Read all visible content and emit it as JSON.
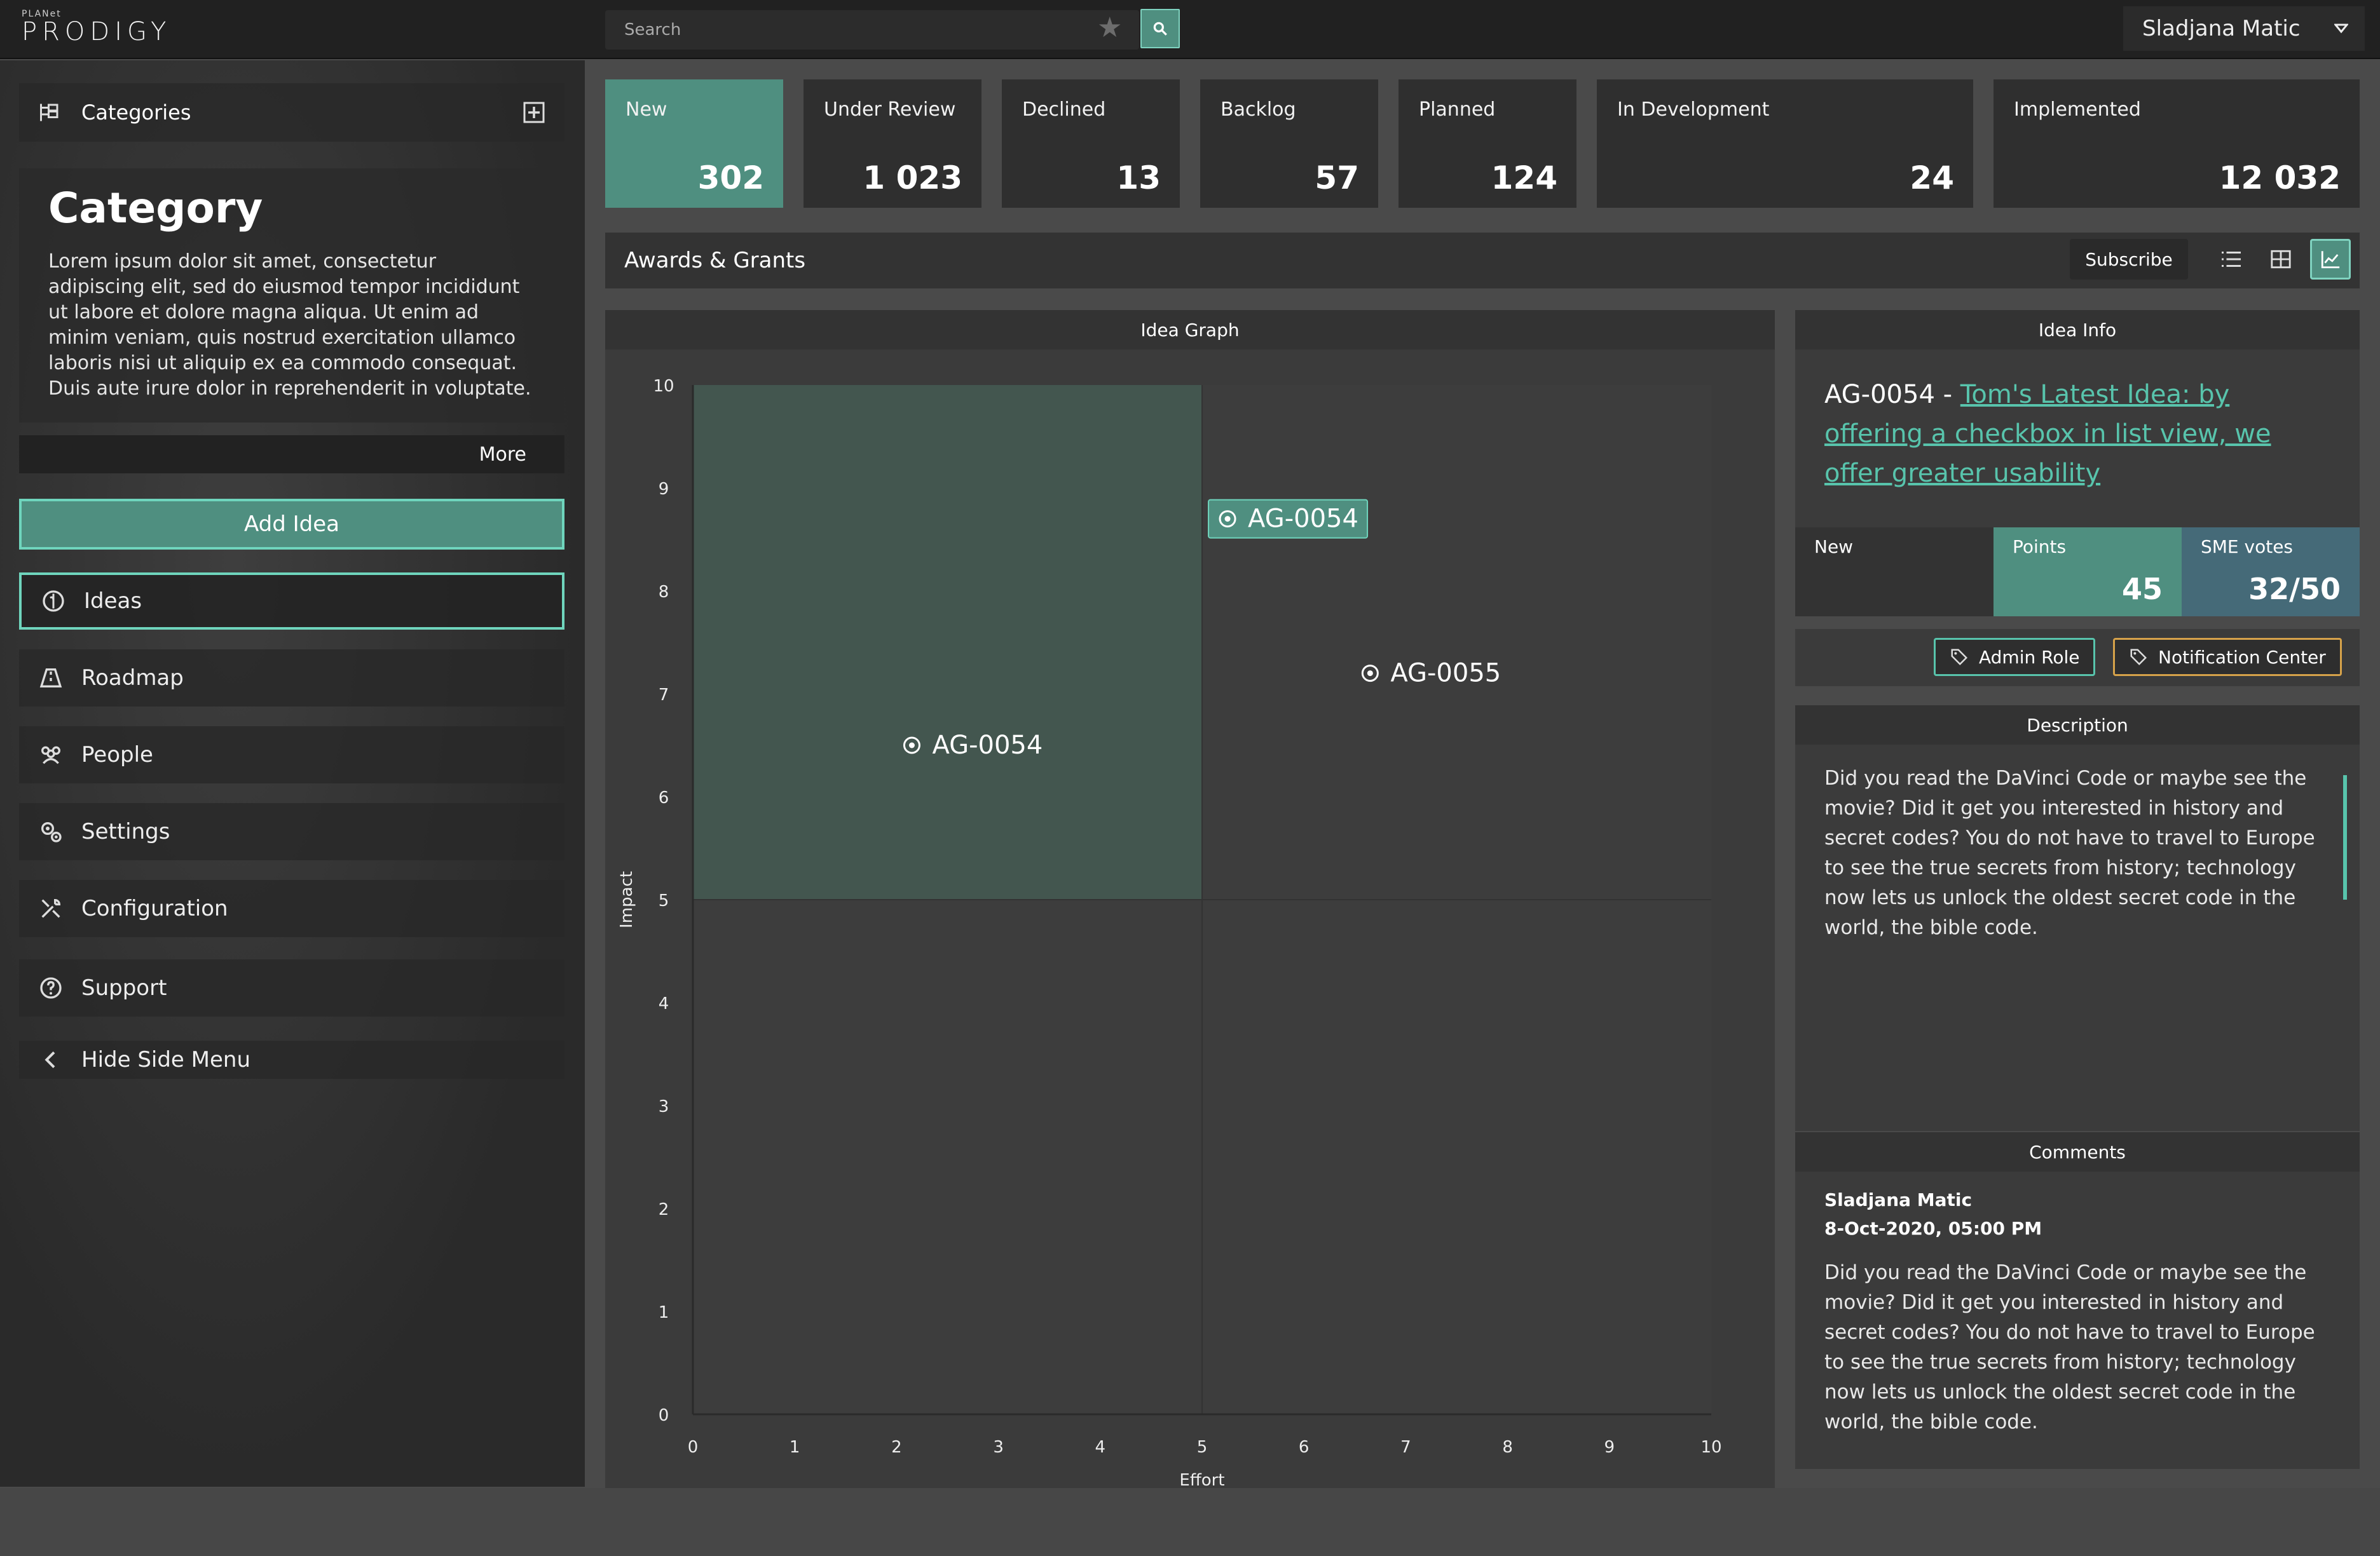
{
  "header": {
    "logo_small": "PLANet",
    "logo_main": "PRODIGY",
    "search_placeholder": "Search",
    "user_name": "Sladjana Matic"
  },
  "sidebar": {
    "categories_label": "Categories",
    "category": {
      "title": "Category",
      "text": "Lorem ipsum dolor sit amet, consectetur adipiscing elit, sed do eiusmod tempor incididunt ut labore et dolore magna aliqua. Ut enim ad minim veniam, quis nostrud exercitation ullamco laboris nisi ut aliquip ex ea commodo consequat. Duis aute irure dolor in reprehenderit in voluptate.",
      "more_label": "More"
    },
    "add_idea_label": "Add Idea",
    "items": [
      {
        "label": "Ideas",
        "icon": "ideas-icon"
      },
      {
        "label": "Roadmap",
        "icon": "roadmap-icon"
      },
      {
        "label": "People",
        "icon": "people-icon"
      },
      {
        "label": "Settings",
        "icon": "settings-icon"
      },
      {
        "label": "Configuration",
        "icon": "configuration-icon"
      },
      {
        "label": "Support",
        "icon": "support-icon"
      },
      {
        "label": "Hide Side Menu",
        "icon": "chevron-left-icon"
      }
    ]
  },
  "statuses": [
    {
      "label": "New",
      "value": "302"
    },
    {
      "label": "Under Review",
      "value": "1 023"
    },
    {
      "label": "Declined",
      "value": "13"
    },
    {
      "label": "Backlog",
      "value": "57"
    },
    {
      "label": "Planned",
      "value": "124"
    },
    {
      "label": "In Development",
      "value": "24"
    },
    {
      "label": "Implemented",
      "value": "12 032"
    }
  ],
  "toolbar": {
    "title": "Awards & Grants",
    "subscribe_label": "Subscribe"
  },
  "graph": {
    "title": "Idea Graph"
  },
  "chart_data": {
    "type": "scatter",
    "xlabel": "Effort",
    "ylabel": "Impact",
    "xlim": [
      0,
      10
    ],
    "ylim": [
      0,
      10
    ],
    "xticks": [
      "0",
      "1",
      "2",
      "3",
      "4",
      "5",
      "6",
      "7",
      "8",
      "9",
      "10"
    ],
    "yticks": [
      "0",
      "1",
      "2",
      "3",
      "4",
      "5",
      "6",
      "7",
      "8",
      "9",
      "10"
    ],
    "highlight_region": {
      "x": [
        0,
        5
      ],
      "y": [
        5,
        10
      ]
    },
    "points": [
      {
        "id": "AG-0054",
        "x": 5.3,
        "y": 8.7,
        "selected": true
      },
      {
        "id": "AG-0054",
        "x": 2.2,
        "y": 6.5,
        "selected": false
      },
      {
        "id": "AG-0055",
        "x": 6.7,
        "y": 7.2,
        "selected": false
      }
    ]
  },
  "info": {
    "panel_title": "Idea Info",
    "idea_id_prefix": "AG-0054 - ",
    "idea_title": "Tom's Latest Idea: by offering a checkbox in list view, we offer greater usability",
    "status": "New",
    "points_label": "Points",
    "points_value": "45",
    "sme_label": "SME votes",
    "sme_value": "32/50",
    "tags": [
      "Admin Role",
      "Notification Center"
    ],
    "description_title": "Description",
    "description": "Did you read the DaVinci Code or maybe see the movie? Did it get you interested in history and secret codes? You do not have to travel to Europe to see the true secrets from history; technology now lets us unlock the oldest secret code in the world, the bible code.",
    "comments_title": "Comments",
    "comment": {
      "author": "Sladjana Matic",
      "date": "8-Oct-2020, 05:00 PM",
      "text": "Did you read the DaVinci Code or maybe see the movie? Did it get you interested in history and secret codes? You do not have to travel to Europe to see the true secrets from history; technology now lets us unlock the oldest secret code in the world, the bible code."
    }
  },
  "colors": {
    "accent": "#4f8f80",
    "accent_bright": "#58c4ac",
    "points_bg": "#4f8f80",
    "sme_bg": "#456a78",
    "tag_admin_border": "#58c4ac",
    "tag_notif_border": "#d6a24a"
  }
}
